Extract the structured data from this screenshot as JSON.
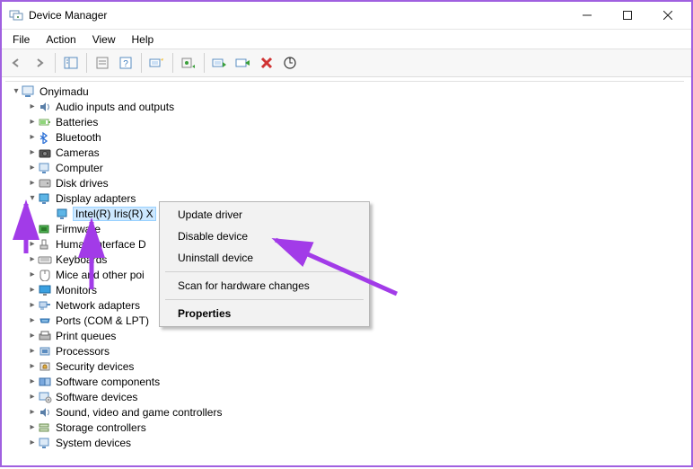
{
  "window": {
    "title": "Device Manager"
  },
  "menubar": {
    "file": "File",
    "action": "Action",
    "view": "View",
    "help": "Help"
  },
  "tree": {
    "root": "Onyimadu",
    "items": [
      "Audio inputs and outputs",
      "Batteries",
      "Bluetooth",
      "Cameras",
      "Computer",
      "Disk drives",
      "Display adapters",
      "Firmware",
      "Human Interface Devices",
      "Keyboards",
      "Mice and other pointing devices",
      "Monitors",
      "Network adapters",
      "Ports (COM & LPT)",
      "Print queues",
      "Processors",
      "Security devices",
      "Software components",
      "Software devices",
      "Sound, video and game controllers",
      "Storage controllers",
      "System devices"
    ],
    "selected_device": "Intel(R) Iris(R) X"
  },
  "context_menu": {
    "update": "Update driver",
    "disable": "Disable device",
    "uninstall": "Uninstall device",
    "scan": "Scan for hardware changes",
    "properties": "Properties"
  },
  "truncated": {
    "hid": "Human Interface D",
    "mice": "Mice and other poi"
  }
}
